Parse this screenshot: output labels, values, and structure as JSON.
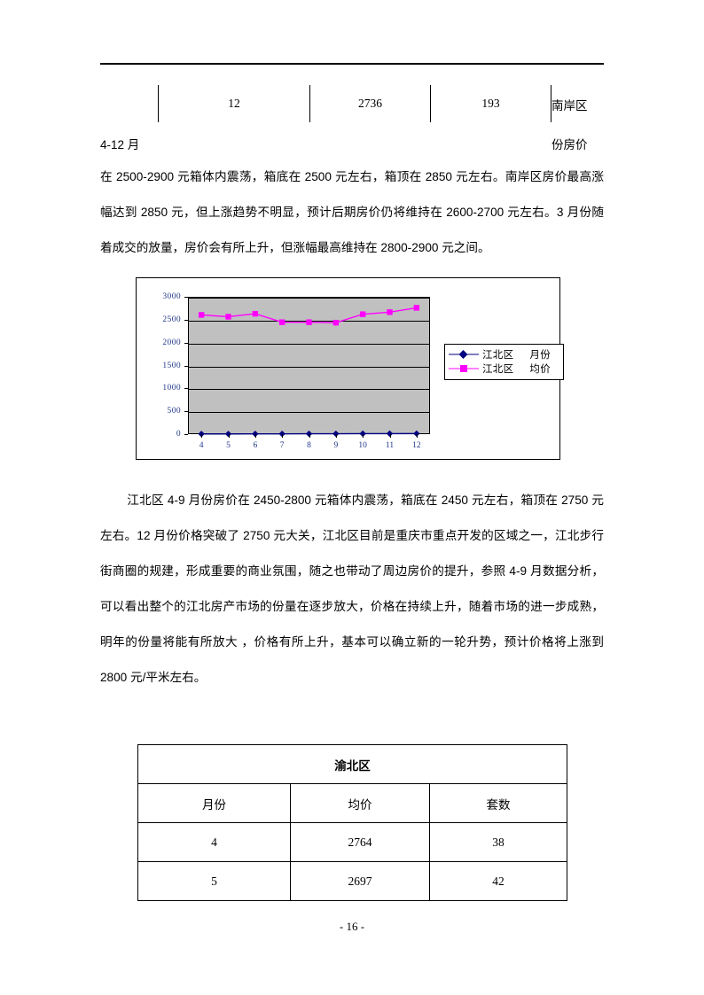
{
  "document": {
    "footer_page_label": "- 16 -"
  },
  "top_table": {
    "row": [
      "12",
      "2736",
      "193"
    ],
    "overflow_label": "南岸区"
  },
  "fragments": {
    "left_line": "4-12 月",
    "right_line": "份房价"
  },
  "paragraphs": {
    "p1": "在 2500-2900 元箱体内震荡，箱底在 2500 元左右，箱顶在 2850 元左右。南岸区房价最高涨幅达到 2850 元，但上涨趋势不明显，预计后期房价仍将维持在 2600-2700 元左右。3 月份随着成交的放量，房价会有所上升，但涨幅最高维持在 2800-2900 元之间。",
    "p2": "江北区 4-9 月份房价在 2450-2800 元箱体内震荡，箱底在 2450 元左右，箱顶在 2750 元左右。12 月份价格突破了 2750 元大关，江北区目前是重庆市重点开发的区域之一，江北步行街商圈的规建，形成重要的商业氛围，随之也带动了周边房价的提升，参照 4-9 月数据分析，可以看出整个的江北房产市场的份量在逐步放大，价格在持续上升，随着市场的进一步成熟，明年的份量将能有所放大 ，价格有所上升，基本可以确立新的一轮升势，预计价格将上涨到 2800 元/平米左右。"
  },
  "chart_data": {
    "type": "line",
    "title": "",
    "xlabel": "",
    "ylabel": "",
    "categories": [
      "4",
      "5",
      "6",
      "7",
      "8",
      "9",
      "10",
      "11",
      "12"
    ],
    "ylim": [
      0,
      3000
    ],
    "yticks": [
      "0",
      "500",
      "1000",
      "1500",
      "2000",
      "2500",
      "3000"
    ],
    "grid": true,
    "legend_position": "right",
    "plot_bg_color": "#c0c0c0",
    "series": [
      {
        "name": "江北区",
        "name_suffix": "月份",
        "color": "#000080",
        "marker": "diamond",
        "values": [
          4,
          5,
          6,
          7,
          8,
          9,
          10,
          11,
          12
        ]
      },
      {
        "name": "江北区",
        "name_suffix": "均价",
        "color": "#ff00ff",
        "marker": "square",
        "values": [
          2605,
          2565,
          2630,
          2445,
          2445,
          2435,
          2620,
          2665,
          2760
        ]
      }
    ]
  },
  "bottom_table": {
    "title": "渝北区",
    "headers": [
      "月份",
      "均价",
      "套数"
    ],
    "rows": [
      [
        "4",
        "2764",
        "38"
      ],
      [
        "5",
        "2697",
        "42"
      ]
    ]
  }
}
